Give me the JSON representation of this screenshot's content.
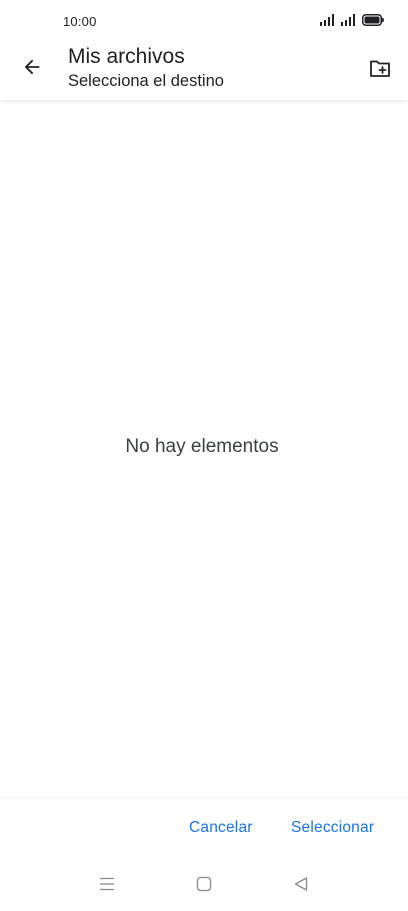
{
  "status_bar": {
    "time": "10:00",
    "icons": [
      "signal-icon",
      "signal-icon",
      "battery-icon"
    ]
  },
  "app_bar": {
    "title": "Mis archivos",
    "subtitle": "Selecciona el destino",
    "back_icon": "arrow-back-icon",
    "new_folder_icon": "create-new-folder-icon"
  },
  "content": {
    "empty_message": "No hay elementos"
  },
  "actions": {
    "cancel_label": "Cancelar",
    "select_label": "Seleccionar"
  },
  "nav_bar": {
    "icons": [
      "menu-icon",
      "home-icon",
      "back-icon"
    ]
  },
  "colors": {
    "accent": "#1a73e8",
    "text": "#202124",
    "background": "#ffffff"
  }
}
